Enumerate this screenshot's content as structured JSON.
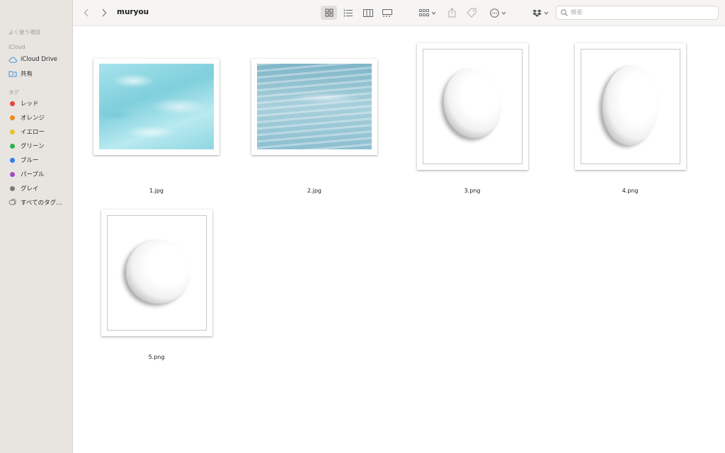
{
  "window": {
    "title": "muryou"
  },
  "sidebar": {
    "favorites_heading": "よく使う項目",
    "icloud_heading": "iCloud",
    "icloud_items": [
      {
        "label": "iCloud Drive",
        "icon": "cloud-icon"
      },
      {
        "label": "共有",
        "icon": "shared-folder-icon"
      }
    ],
    "tags_heading": "タグ",
    "tags": [
      {
        "label": "レッド",
        "color": "#e8433a"
      },
      {
        "label": "オレンジ",
        "color": "#ef8a1e"
      },
      {
        "label": "イエロー",
        "color": "#e9c12b"
      },
      {
        "label": "グリーン",
        "color": "#2eb04c"
      },
      {
        "label": "ブルー",
        "color": "#2f7ef0"
      },
      {
        "label": "パープル",
        "color": "#a24ac2"
      },
      {
        "label": "グレイ",
        "color": "#7a7a7a"
      }
    ],
    "all_tags": "すべてのタグ…"
  },
  "toolbar": {
    "back_icon": "chevron-left-icon",
    "forward_icon": "chevron-right-icon",
    "view_modes": [
      "icon-view-icon",
      "list-view-icon",
      "column-view-icon",
      "gallery-view-icon"
    ],
    "selected_view": "icon-view-icon",
    "search_placeholder": "検索"
  },
  "files": [
    {
      "name": "1.jpg",
      "kind": "water-light"
    },
    {
      "name": "2.jpg",
      "kind": "water-dark"
    },
    {
      "name": "3.png",
      "kind": "oval-tilted"
    },
    {
      "name": "4.png",
      "kind": "oval-tall"
    },
    {
      "name": "5.png",
      "kind": "circle"
    }
  ]
}
